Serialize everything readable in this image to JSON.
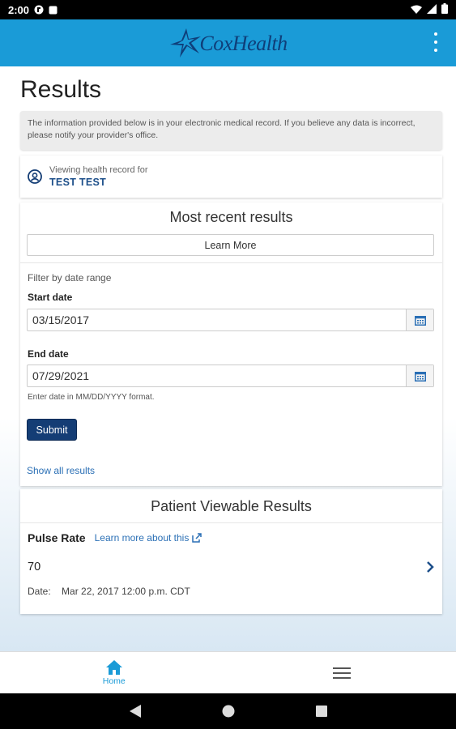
{
  "status_bar": {
    "time": "2:00"
  },
  "app": {
    "brand": "CoxHealth"
  },
  "page": {
    "title": "Results"
  },
  "notice": {
    "text": "The information provided below is in your electronic medical record. If you believe any data is incorrect, please notify your provider's office."
  },
  "viewing": {
    "label": "Viewing health record for",
    "name": "TEST TEST"
  },
  "recent": {
    "title": "Most recent results",
    "learn_more": "Learn More",
    "filter_label": "Filter by date range",
    "start_label": "Start date",
    "start_value": "03/15/2017",
    "end_label": "End date",
    "end_value": "07/29/2021",
    "hint": "Enter date in MM/DD/YYYY format.",
    "submit": "Submit",
    "show_all": "Show all results"
  },
  "patient_results": {
    "title": "Patient Viewable Results",
    "items": [
      {
        "name": "Pulse Rate",
        "learn_link": "Learn more about this",
        "value": "70",
        "date_label": "Date:",
        "date": "Mar 22, 2017 12:00 p.m. CDT"
      }
    ]
  },
  "bottom_nav": {
    "home_label": "Home"
  },
  "colors": {
    "header": "#1a9bd7",
    "brand_navy": "#143d75",
    "link": "#2a6fb5"
  }
}
